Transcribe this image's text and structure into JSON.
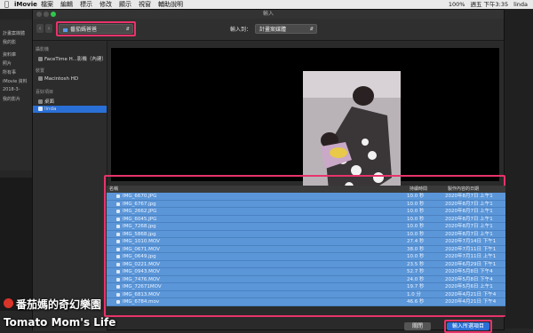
{
  "menubar": {
    "app": "iMovie",
    "menus": [
      "檔案",
      "編輯",
      "標示",
      "修改",
      "顯示",
      "視窗",
      "輔助說明"
    ],
    "status": [
      "100%",
      "週五 下午3:35",
      "linda"
    ]
  },
  "background_app": {
    "sidebar": [
      "計畫案媒體",
      "我的影",
      "資料庫",
      "照片",
      "所有事",
      "iMovie 資料",
      "2018-3-",
      "我的影片"
    ]
  },
  "dialog": {
    "title": "輸入",
    "source_select": "番茄媽爸爸",
    "import_to_label": "輸入到：",
    "event_select": "計畫案媒體",
    "sidebar": {
      "sections": [
        {
          "label": "攝影機",
          "items": [
            "FaceTime H...影機（內建）"
          ]
        },
        {
          "label": "裝置",
          "items": [
            "Macintosh HD"
          ]
        },
        {
          "label": "喜好項目",
          "items": [
            "桌面",
            "linda"
          ]
        }
      ],
      "selected": "linda"
    },
    "table": {
      "headers": [
        "名稱",
        "持續時間",
        "製作內容的日期"
      ],
      "rows": [
        {
          "name": "IMG_6670.JPG",
          "duration": "10.0 秒",
          "date": "2020年8月7日 上午1"
        },
        {
          "name": "IMG_6767.jpg",
          "duration": "10.0 秒",
          "date": "2020年8月7日 上午1"
        },
        {
          "name": "IMG_2662.JPG",
          "duration": "10.0 秒",
          "date": "2020年8月7日 上午1"
        },
        {
          "name": "IMG_6045.JPG",
          "duration": "10.0 秒",
          "date": "2020年8月7日 上午1"
        },
        {
          "name": "IMG_7268.jpg",
          "duration": "10.0 秒",
          "date": "2020年8月7日 上午1"
        },
        {
          "name": "IMG_5868.jpg",
          "duration": "10.0 秒",
          "date": "2020年8月7日 上午1"
        },
        {
          "name": "IMG_1010.MOV",
          "duration": "27.4 秒",
          "date": "2020年7月14日 下午1"
        },
        {
          "name": "IMG_0671.MOV",
          "duration": "38.0 秒",
          "date": "2020年7月11日 下午1"
        },
        {
          "name": "IMG_0649.jpg",
          "duration": "10.0 秒",
          "date": "2020年7月11日 上午1"
        },
        {
          "name": "IMG_0221.MOV",
          "duration": "23.5 秒",
          "date": "2020年6月29日 下午1"
        },
        {
          "name": "IMG_0943.MOV",
          "duration": "52.7 秒",
          "date": "2020年5月8日 下午4"
        },
        {
          "name": "IMG_7476.MOV",
          "duration": "24.0 秒",
          "date": "2020年5月8日 下午4"
        },
        {
          "name": "IMG_72671MOV",
          "duration": "19.7 秒",
          "date": "2020年5月6日 上午1"
        },
        {
          "name": "IMG_6813.MOV",
          "duration": "1.0 分",
          "date": "2020年4月21日 下午4"
        },
        {
          "name": "IMG_6784.mov",
          "duration": "46.6 秒",
          "date": "2020年4月21日 下午4"
        }
      ]
    },
    "buttons": {
      "close": "關閉",
      "import_all": "輸入所選項目"
    }
  },
  "watermark": {
    "line1": "番茄媽的奇幻樂園",
    "line2": "Tomato Mom's Life"
  },
  "colors": {
    "highlight": "#e8336a",
    "selection": "#5b96d8",
    "primary_button": "#2a6fd6"
  }
}
